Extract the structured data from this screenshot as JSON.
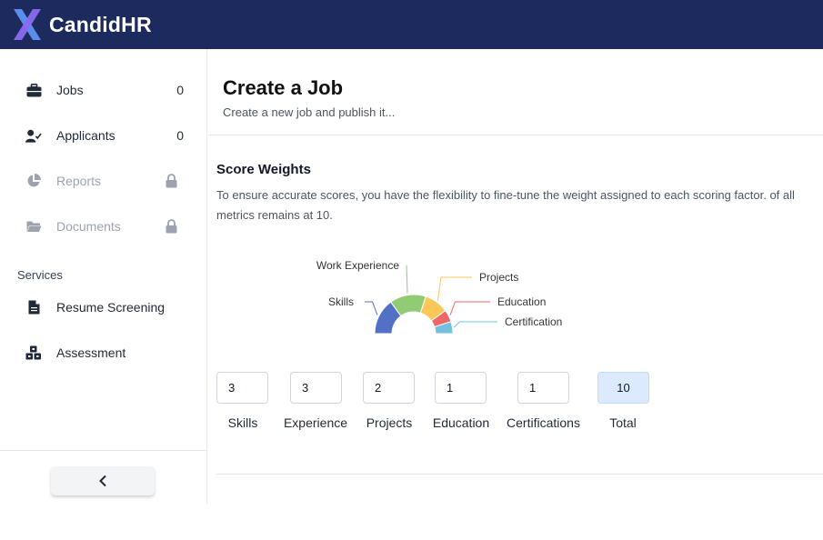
{
  "app": {
    "brand": "CandidHR"
  },
  "colors": {
    "topbar": "#1d2a5d",
    "accent": "#3b5bdb",
    "total_box": "#dbeafe"
  },
  "sidebar": {
    "items": [
      {
        "label": "Jobs",
        "count": "0",
        "icon": "briefcase-icon",
        "locked": false
      },
      {
        "label": "Applicants",
        "count": "0",
        "icon": "user-check-icon",
        "locked": false
      },
      {
        "label": "Reports",
        "icon": "pie-chart-icon",
        "locked": true
      },
      {
        "label": "Documents",
        "icon": "folder-icon",
        "locked": true
      }
    ],
    "services_label": "Services",
    "services": [
      {
        "label": "Resume Screening",
        "icon": "document-icon"
      },
      {
        "label": "Assessment",
        "icon": "cubes-icon"
      }
    ],
    "collapse_icon": "chevron-left-icon"
  },
  "main": {
    "title": "Create a Job",
    "subtitle": "Create a new job and publish it...",
    "section_title": "Score Weights",
    "section_desc": "To ensure accurate scores, you have the flexibility to fine-tune the weight assigned to each scoring factor. of all metrics remains at 10."
  },
  "chart_data": {
    "type": "pie",
    "shape": "half-donut",
    "categories": [
      "Skills",
      "Work Experience",
      "Projects",
      "Education",
      "Certification"
    ],
    "values": [
      3,
      3,
      2,
      1,
      1
    ],
    "colors": [
      "#5470c6",
      "#91cc75",
      "#fac858",
      "#ee6666",
      "#73c0de"
    ]
  },
  "weights": [
    {
      "label": "Skills",
      "value": "3"
    },
    {
      "label": "Experience",
      "value": "3"
    },
    {
      "label": "Projects",
      "value": "2"
    },
    {
      "label": "Education",
      "value": "1"
    },
    {
      "label": "Certifications",
      "value": "1"
    }
  ],
  "total": {
    "label": "Total",
    "value": "10"
  }
}
